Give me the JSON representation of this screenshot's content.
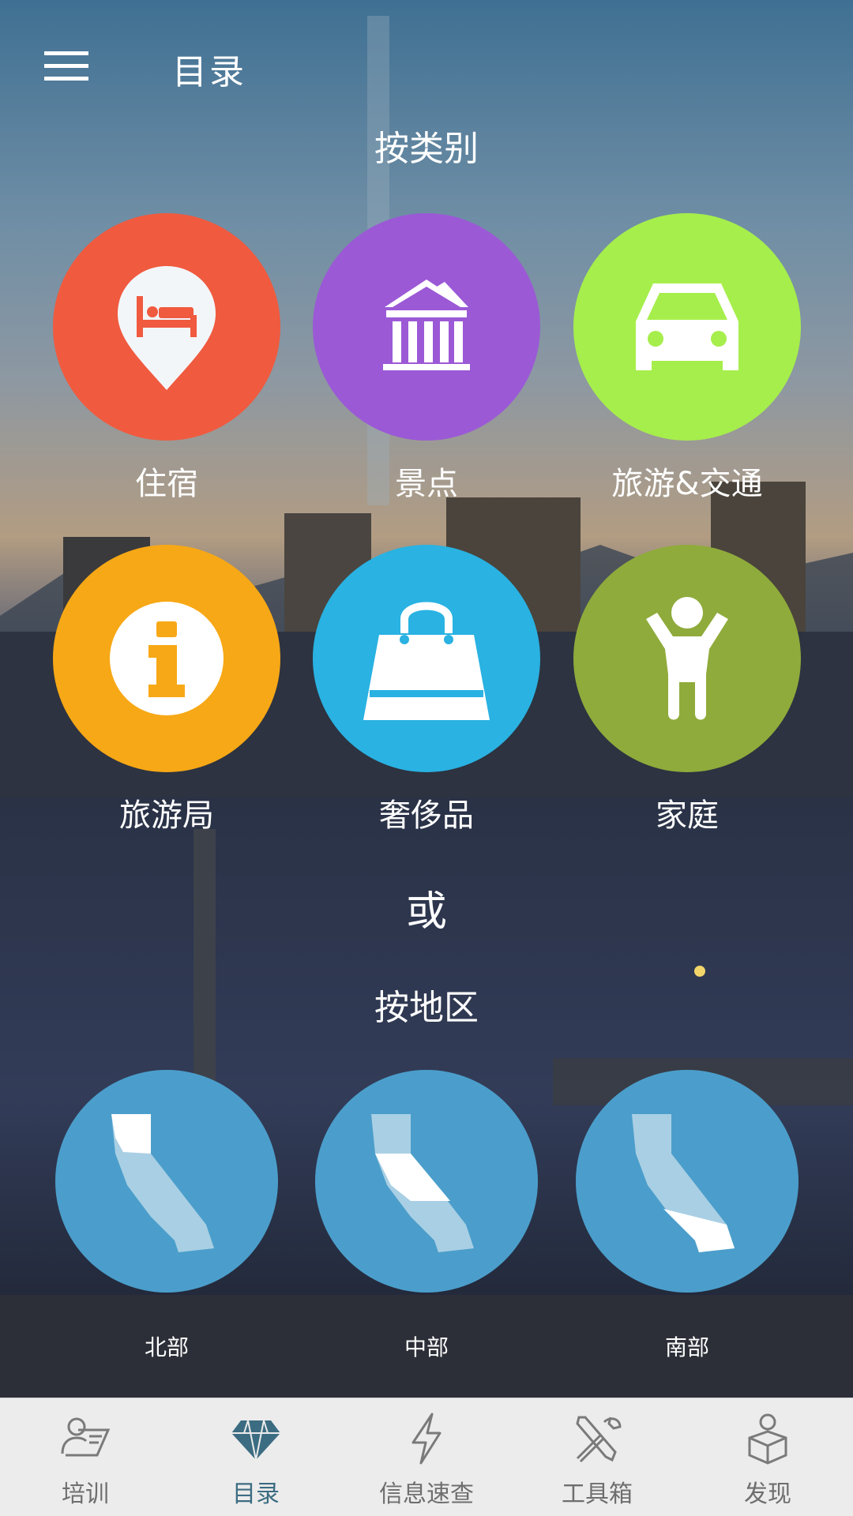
{
  "header": {
    "title": "目录"
  },
  "category_section": {
    "title": "按类别",
    "items": [
      {
        "label": "住宿",
        "icon": "lodging-pin-bed-icon",
        "color": "#f05a3f"
      },
      {
        "label": "景点",
        "icon": "attractions-landmark-icon",
        "color": "#9b59d6"
      },
      {
        "label": "旅游&交通",
        "icon": "car-transport-icon",
        "color": "#a6ee4c"
      },
      {
        "label": "旅游局",
        "icon": "info-icon",
        "color": "#f7a816"
      },
      {
        "label": "奢侈品",
        "icon": "shopping-bag-icon",
        "color": "#29b2e2"
      },
      {
        "label": "家庭",
        "icon": "family-child-icon",
        "color": "#8fab3b"
      }
    ]
  },
  "or_text": "或",
  "region_section": {
    "title": "按地区",
    "items": [
      {
        "label": "北部",
        "icon": "california-north-map-icon"
      },
      {
        "label": "中部",
        "icon": "california-central-map-icon"
      },
      {
        "label": "南部",
        "icon": "california-south-map-icon"
      }
    ],
    "color": "#4b9ecb"
  },
  "bottom_nav": {
    "items": [
      {
        "label": "培训",
        "icon": "training-icon",
        "active": false
      },
      {
        "label": "目录",
        "icon": "diamond-icon",
        "active": true
      },
      {
        "label": "信息速查",
        "icon": "lightning-icon",
        "active": false
      },
      {
        "label": "工具箱",
        "icon": "tools-icon",
        "active": false
      },
      {
        "label": "发现",
        "icon": "discover-person-box-icon",
        "active": false
      }
    ]
  }
}
